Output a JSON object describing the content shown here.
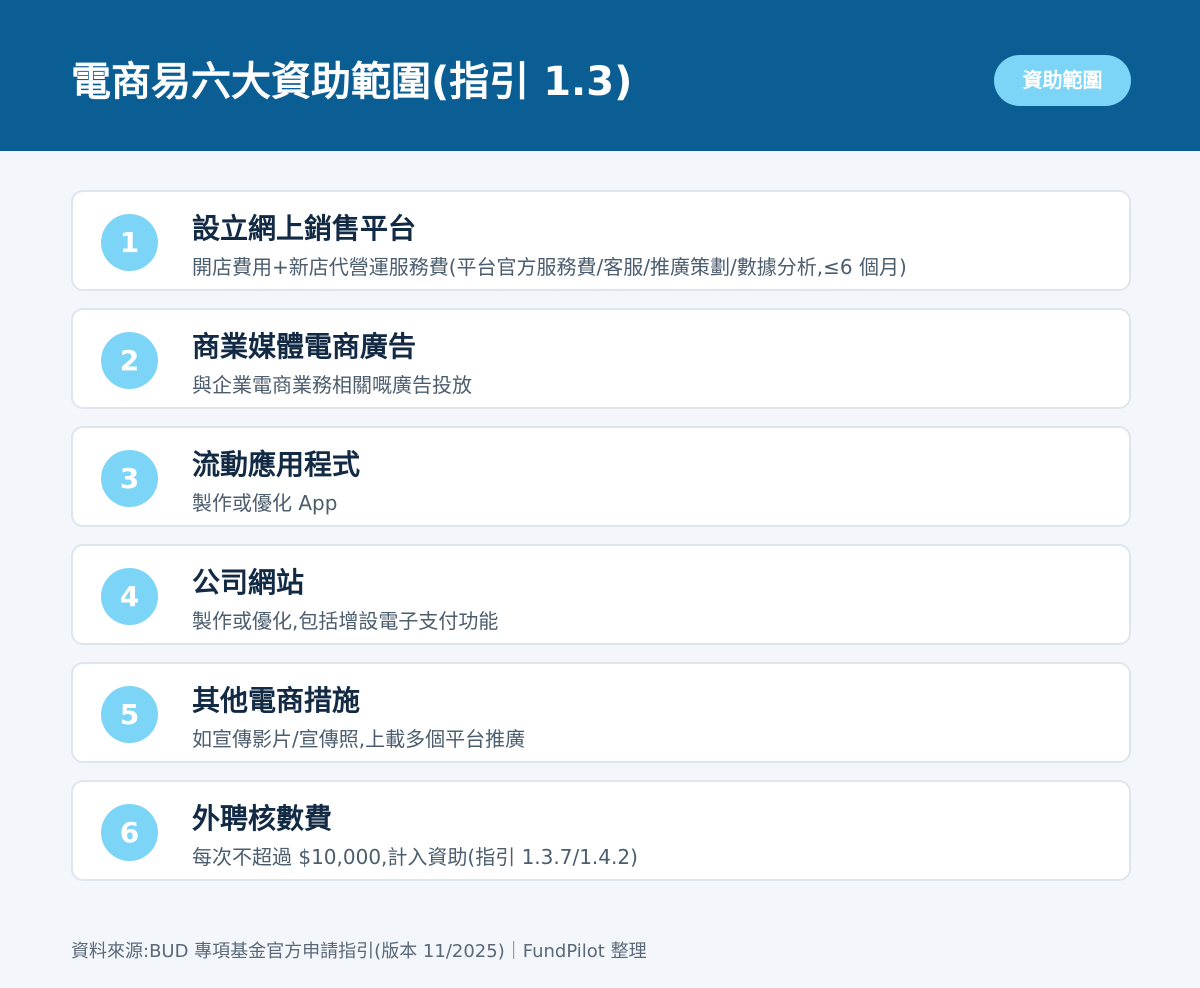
{
  "header": {
    "title": "電商易六大資助範圍(指引 1.3)",
    "badge": "資助範圍"
  },
  "items": [
    {
      "number": "1",
      "title": "設立網上銷售平台",
      "description": "開店費用+新店代營運服務費(平台官方服務費/客服/推廣策劃/數據分析,≤6 個月)"
    },
    {
      "number": "2",
      "title": "商業媒體電商廣告",
      "description": "與企業電商業務相關嘅廣告投放"
    },
    {
      "number": "3",
      "title": "流動應用程式",
      "description": "製作或優化 App"
    },
    {
      "number": "4",
      "title": "公司網站",
      "description": "製作或優化,包括增設電子支付功能"
    },
    {
      "number": "5",
      "title": "其他電商措施",
      "description": "如宣傳影片/宣傳照,上載多個平台推廣"
    },
    {
      "number": "6",
      "title": "外聘核數費",
      "description": "每次不超過 $10,000,計入資助(指引 1.3.7/1.4.2)"
    }
  ],
  "footer": {
    "source": "資料來源:BUD 專項基金官方申請指引(版本 11/2025)｜FundPilot 整理"
  },
  "colors": {
    "header_bg": "#0a5e94",
    "accent": "#7cd4f7",
    "page_bg": "#f3f7fb",
    "card_border": "#dde6ef",
    "title_text": "#132a44",
    "desc_text": "#4c5d6e"
  }
}
